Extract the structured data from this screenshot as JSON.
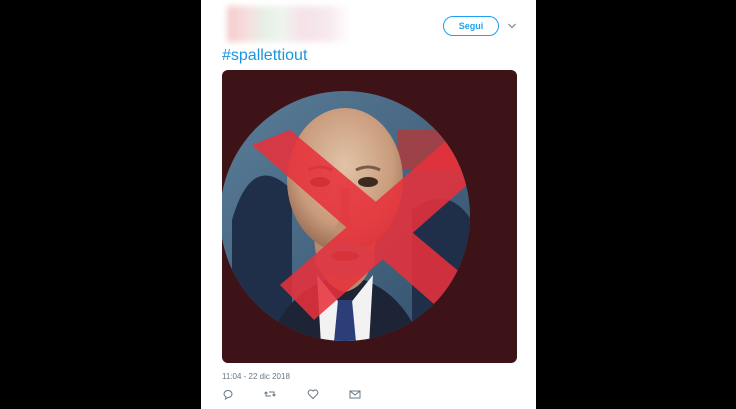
{
  "tweet": {
    "follow_label": "Segui",
    "hashtag": "#spallettiout",
    "timestamp": "11:04 - 22 dic 2018"
  },
  "icons": {
    "menu": "chevron-down-icon",
    "reply": "reply-icon",
    "retweet": "retweet-icon",
    "like": "heart-icon",
    "message": "envelope-icon"
  },
  "colors": {
    "accent": "#1da1f2",
    "media_background": "#3d1317",
    "cross": "#e8323c"
  }
}
